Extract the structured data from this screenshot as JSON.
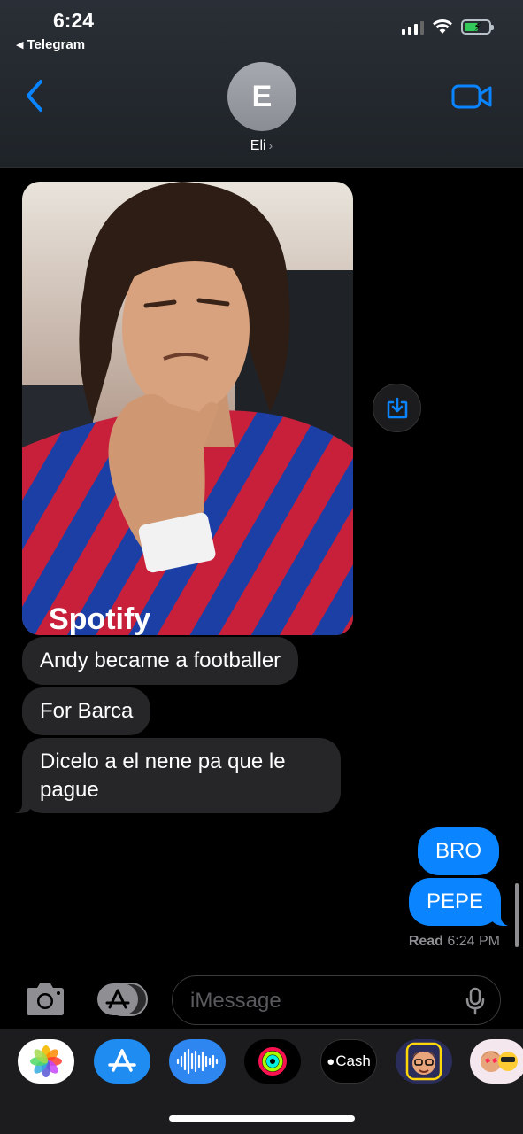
{
  "status_bar": {
    "time": "6:24",
    "back_app_label": "Telegram"
  },
  "header": {
    "avatar_initial": "E",
    "contact_name": "Eli"
  },
  "messages": {
    "photo_alt": "Footballer in Barcelona kit",
    "incoming": [
      "Andy became a footballer",
      "For Barca",
      "Dicelo a el nene pa que le pague"
    ],
    "outgoing": [
      "BRO",
      "PEPE"
    ],
    "read_label": "Read",
    "read_time": "6:24 PM"
  },
  "composer": {
    "placeholder": "iMessage"
  },
  "app_drawer": {
    "cash_label": "Cash",
    "icons": [
      "photos-icon",
      "app-store-icon",
      "audio-message-icon",
      "fitness-icon",
      "apple-cash-icon",
      "memoji-icon",
      "memoji-stickers-icon"
    ]
  },
  "colors": {
    "accent": "#0a84ff",
    "incoming_bubble": "#262628",
    "background": "#000000"
  }
}
